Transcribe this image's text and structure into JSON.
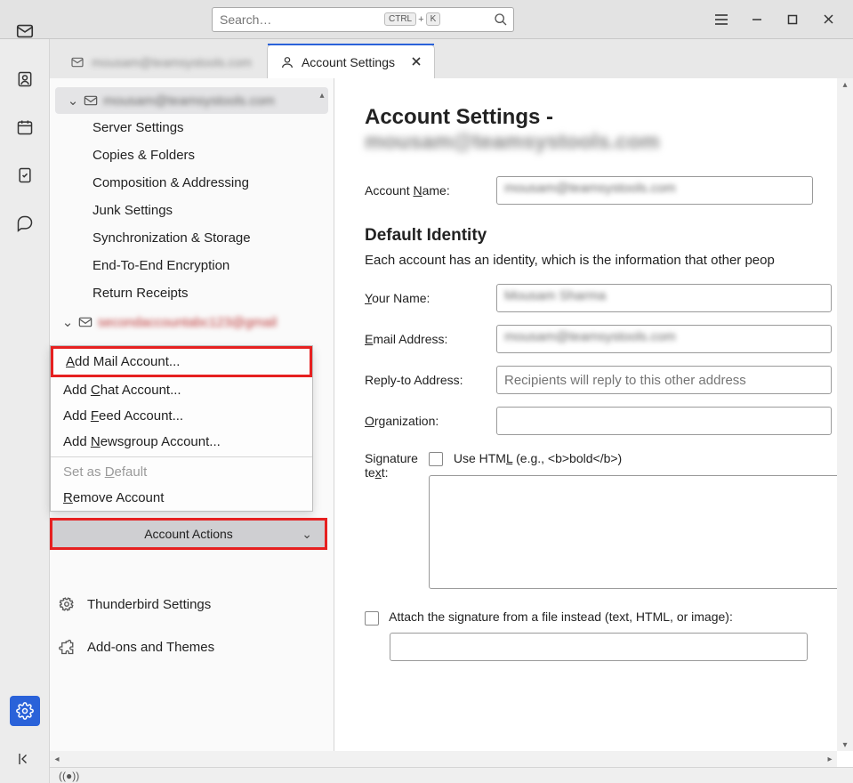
{
  "search": {
    "placeholder": "Search…",
    "kbd1": "CTRL",
    "kbd_plus": "+",
    "kbd2": "K"
  },
  "tabs": {
    "account_tab_blur": "mousam@teamsystools.com",
    "settings_label": "Account Settings"
  },
  "sidebar": {
    "account1_blur": "mousam@teamsystools.com",
    "items": [
      "Server Settings",
      "Copies & Folders",
      "Composition & Addressing",
      "Junk Settings",
      "Synchronization & Storage",
      "End-To-End Encryption",
      "Return Receipts"
    ],
    "account2_blur": "secondaccountabc123@gmail",
    "popup": {
      "add_mail": {
        "pre": "",
        "u": "A",
        "post": "dd Mail Account..."
      },
      "add_chat": {
        "pre": "Add ",
        "u": "C",
        "post": "hat Account..."
      },
      "add_feed": {
        "pre": "Add ",
        "u": "F",
        "post": "eed Account..."
      },
      "add_news": {
        "pre": "Add ",
        "u": "N",
        "post": "ewsgroup Account..."
      },
      "set_default": {
        "pre": "Set as ",
        "u": "D",
        "post": "efault"
      },
      "remove": {
        "pre": "",
        "u": "R",
        "post": "emove Account"
      }
    },
    "account_actions": {
      "pre": "",
      "u": "A",
      "post": "ccount Actions"
    },
    "thunderbird_settings": "Thunderbird Settings",
    "addons": "Add-ons and Themes"
  },
  "page": {
    "heading_prefix": "Account Settings - ",
    "heading_blur": "mousam@teamsystools.com",
    "fields": {
      "account_name": {
        "label_pre": "Account ",
        "label_u": "N",
        "label_post": "ame:",
        "value_blur": "mousam@teamsystools.com"
      },
      "identity_heading": "Default Identity",
      "identity_desc": "Each account has an identity, which is the information that other peop",
      "your_name": {
        "label_u": "Y",
        "label_post": "our Name:",
        "value_blur": "Mousam Sharma"
      },
      "email": {
        "label_u": "E",
        "label_post": "mail Address:",
        "value_blur": "mousam@teamsystools.com"
      },
      "reply_to": {
        "label": "Reply-to Address:",
        "placeholder": "Recipients will reply to this other address"
      },
      "organization": {
        "label_u": "O",
        "label_post": "rganization:"
      },
      "signature": {
        "label_pre": "Signature te",
        "label_u": "x",
        "label_post": "t:",
        "use_html_pre": "Use HTM",
        "use_html_u": "L",
        "use_html_post": " (e.g., <b>bold</b>)"
      },
      "attach_sig": {
        "pre": "",
        "u": "A",
        "post": "ttach the signature from a file instead (text, HTML, or image):"
      }
    }
  },
  "statusbar": {
    "sync": "((●))"
  }
}
